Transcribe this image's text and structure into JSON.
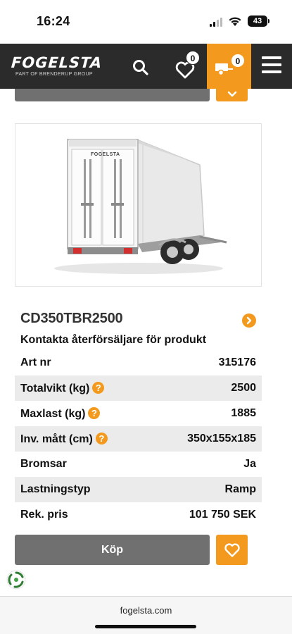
{
  "status_bar": {
    "time": "16:24",
    "battery": "43"
  },
  "header": {
    "brand": "FOGELSTA",
    "tagline": "PART OF BRENDERUP GROUP",
    "favorites_count": "0",
    "cart_count": "0",
    "accent_color": "#f39a1e",
    "background_color": "#2b2b2b"
  },
  "product": {
    "model": "CD350TBR2500",
    "contact_text": "Kontakta återförsäljare för produkt",
    "image_brand_mark": "FOGELSTA",
    "specs": [
      {
        "label": "Art nr",
        "value": "315176",
        "info": false
      },
      {
        "label": "Totalvikt (kg)",
        "value": "2500",
        "info": true
      },
      {
        "label": "Maxlast (kg)",
        "value": "1885",
        "info": true
      },
      {
        "label": "Inv. mått (cm)",
        "value": "350x155x185",
        "info": true
      },
      {
        "label": "Bromsar",
        "value": "Ja",
        "info": false
      },
      {
        "label": "Lastningstyp",
        "value": "Ramp",
        "info": false
      },
      {
        "label": "Rek. pris",
        "value": "101 750 SEK",
        "info": false
      }
    ],
    "info_symbol": "?",
    "buy_label": "Köp"
  },
  "browser": {
    "url": "fogelsta.com"
  }
}
